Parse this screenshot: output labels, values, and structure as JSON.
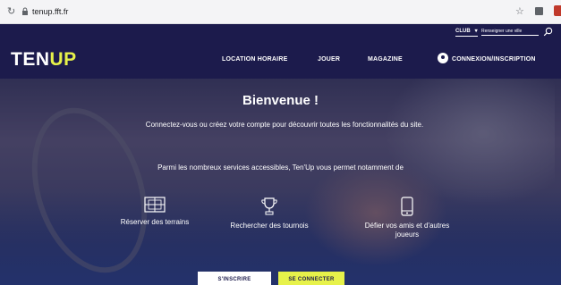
{
  "browser": {
    "url": "tenup.fft.fr"
  },
  "util_bar": {
    "club_label": "CLUB",
    "city_placeholder": "Renseigner une ville"
  },
  "nav": {
    "logo_ten": "TEN",
    "logo_up": "UP",
    "links": [
      {
        "label": "LOCATION HORAIRE"
      },
      {
        "label": "JOUER"
      },
      {
        "label": "MAGAZINE"
      },
      {
        "label": "CONNEXION/INSCRIPTION"
      }
    ]
  },
  "hero": {
    "title": "Bienvenue !",
    "intro": "Connectez-vous ou créez votre compte pour découvrir toutes les fonctionnalités du site.",
    "services_text": "Parmi les nombreux services accessibles, Ten'Up vous permet notamment de",
    "features": [
      {
        "icon": "court-icon",
        "label": "Réserver des terrains"
      },
      {
        "icon": "trophy-icon",
        "label": "Rechercher des tournois"
      },
      {
        "icon": "phone-icon",
        "label": "Défier vos amis et d'autres joueurs"
      }
    ],
    "buttons": {
      "signup": "S'INSCRIRE",
      "login": "SE CONNECTER"
    }
  },
  "colors": {
    "navy": "#1c1b4c",
    "accent_yellow": "#e7f24a"
  }
}
